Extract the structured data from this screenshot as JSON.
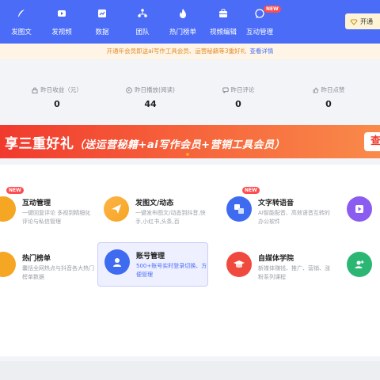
{
  "nav": {
    "items": [
      {
        "label": "发图文",
        "icon": "feather-icon"
      },
      {
        "label": "发视频",
        "icon": "video-icon"
      },
      {
        "label": "数据",
        "icon": "chart-icon"
      },
      {
        "label": "团队",
        "icon": "team-icon"
      },
      {
        "label": "热门榜单",
        "icon": "fire-icon"
      },
      {
        "label": "视频编辑",
        "icon": "briefcase-icon"
      },
      {
        "label": "互动管理",
        "icon": "chat-icon",
        "badge": "NEW"
      }
    ],
    "open_button": "开通"
  },
  "promo": {
    "text": "开通年会员即送ai写作工具会员、运营秘籍等3重好礼",
    "link": "查看详情"
  },
  "stats": [
    {
      "label": "昨日收益（元）",
      "value": "0"
    },
    {
      "label": "昨日播放(阅读)",
      "value": "44"
    },
    {
      "label": "昨日评论",
      "value": "0"
    },
    {
      "label": "昨日点赞",
      "value": "0"
    }
  ],
  "banner": {
    "main": "享三重好礼",
    "sub": "（送运营秘籍+ai写作会员+营销工具会员）",
    "button": "查"
  },
  "tools": [
    {
      "title": "互动管理",
      "desc": "一键回复评论 多视到精细化评论与私信管理",
      "badge": "NEW",
      "color": "#f5a623"
    },
    {
      "title": "发图文/动态",
      "desc": "一键发布图文/动态到抖音,快手,小红书,头条,百",
      "color": "#f5a623"
    },
    {
      "title": "文字转语音",
      "desc": "AI智能配音、高效语音互转的办公软件",
      "badge": "NEW",
      "color": "#3e6bf0"
    },
    {
      "title": "热门榜单",
      "desc": "囊括全网热点与抖音各大热门榜单数据",
      "color": "#f5a623"
    },
    {
      "title": "账号管理",
      "desc": "500+账号实时登录切换、方便管理",
      "color": "#3e6bf0"
    },
    {
      "title": "自媒体学院",
      "desc": "新媒体赚钱、推广、营销、涨粉系列课程",
      "color": "#f04a3e"
    }
  ],
  "colors": {
    "nav": "#4a6cf7",
    "banner": "#f03a2e",
    "active": "#eef0ff"
  }
}
